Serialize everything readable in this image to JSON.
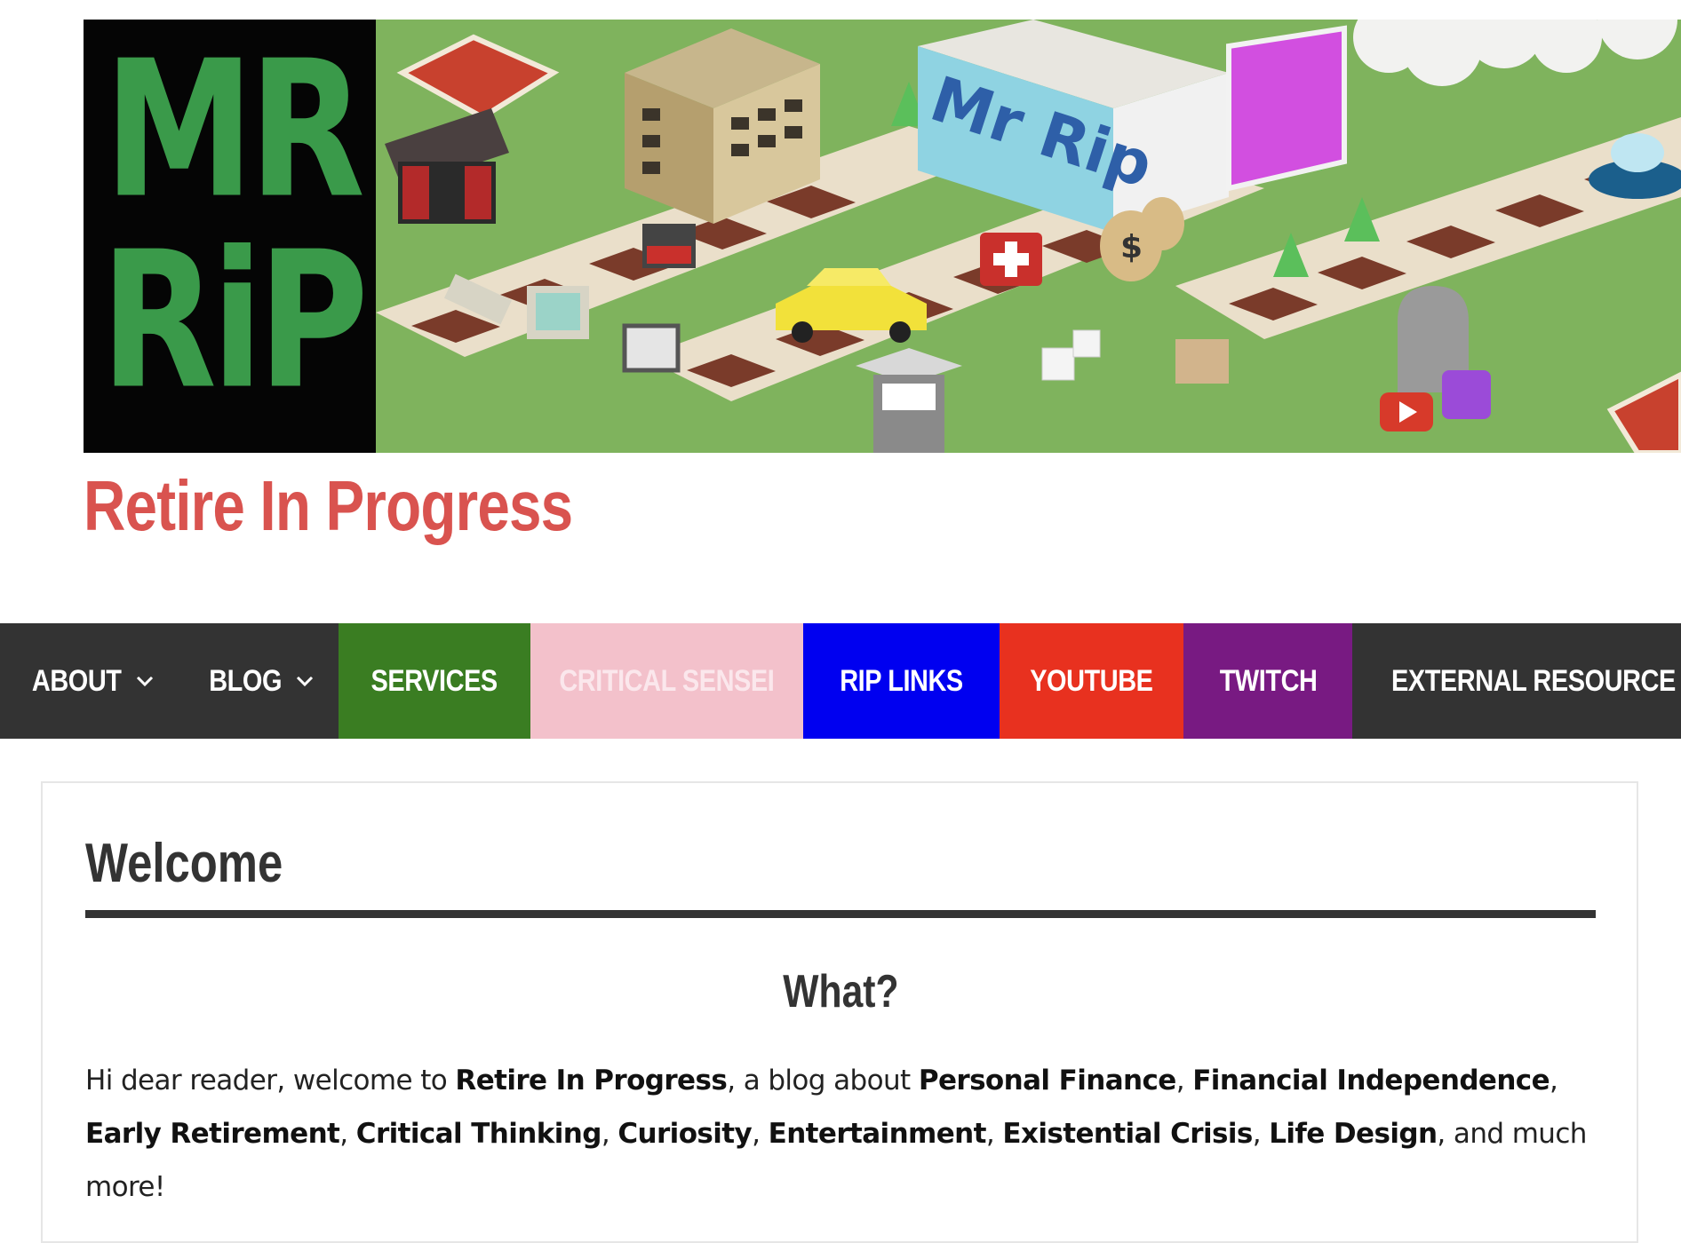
{
  "header": {
    "logo_line1": "MR",
    "logo_line2": "RiP",
    "site_title": "Retire In Progress",
    "banner_sign_text": "Mr Rip"
  },
  "nav": {
    "items": [
      {
        "label": "About",
        "has_dropdown": true
      },
      {
        "label": "Blog",
        "has_dropdown": true
      },
      {
        "label": "Services",
        "has_dropdown": false,
        "color": "#3a7d22"
      },
      {
        "label": "Critical Sensei",
        "has_dropdown": false,
        "color": "#f3c1cb"
      },
      {
        "label": "RIP Links",
        "has_dropdown": false,
        "color": "#0000f0"
      },
      {
        "label": "YouTube",
        "has_dropdown": false,
        "color": "#e8311f"
      },
      {
        "label": "Twitch",
        "has_dropdown": false,
        "color": "#781a82"
      },
      {
        "label": "External Resource",
        "has_dropdown": false
      }
    ]
  },
  "content": {
    "page_title": "Welcome",
    "section_heading": "What?",
    "intro_parts": {
      "p0": "Hi dear reader, welcome to ",
      "b0": "Retire In Progress",
      "p1": ", a blog about ",
      "b1": "Personal Finance",
      "p2": ", ",
      "b2": "Financial Independence",
      "p3": ", ",
      "b3": "Early Retirement",
      "p4": ", ",
      "b4": "Critical Thinking",
      "p5": ", ",
      "b5": "Curiosity",
      "p6": ", ",
      "b6": "Entertainment",
      "p7": ", ",
      "b7": "Existential Crisis",
      "p8": ", ",
      "b8": "Life Design",
      "p9": ", and much more!"
    }
  },
  "colors": {
    "site_title": "#d9534f",
    "nav_background": "#333333",
    "text": "#222222"
  }
}
